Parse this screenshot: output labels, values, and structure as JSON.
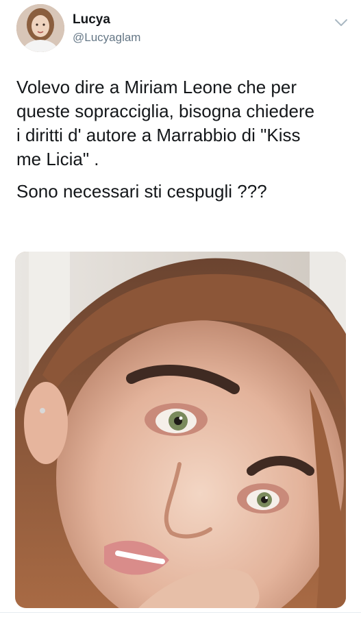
{
  "user": {
    "display_name": "Lucya",
    "handle": "@Lucyaglam",
    "avatar_icon": "profile-photo"
  },
  "tweet": {
    "paragraphs": [
      "Volevo dire a Miriam Leone che per\nqueste sopracciglia, bisogna chiedere\ni diritti d' autore a Marrabbio di \"Kiss\nme Licia\" .",
      "Sono necessari sti cespugli ???"
    ]
  },
  "media": {
    "description_icon": "photo-of-woman-face"
  },
  "icons": {
    "menu": "chevron-down-icon"
  },
  "colors": {
    "text": "#14171a",
    "secondary_text": "#657786",
    "divider": "#e6ecf0"
  }
}
